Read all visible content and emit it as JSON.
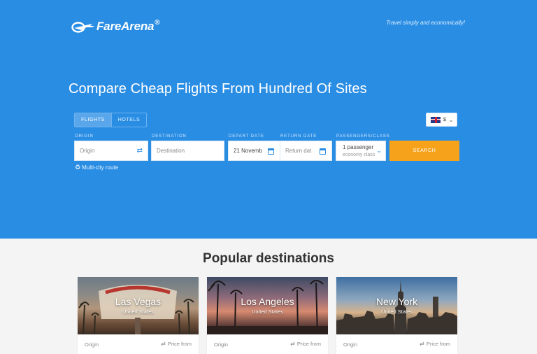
{
  "header": {
    "logo_text": "FareArena",
    "logo_reg": "®",
    "tagline": "Travel simply and economically!"
  },
  "hero": {
    "headline": "Compare Cheap Flights From Hundred Of Sites"
  },
  "tabs": [
    {
      "label": "FLIGHTS",
      "active": true
    },
    {
      "label": "HOTELS",
      "active": false
    }
  ],
  "currency": {
    "symbol": "$"
  },
  "search": {
    "origin_label": "ORIGIN",
    "origin_placeholder": "Origin",
    "destination_label": "DESTINATION",
    "destination_placeholder": "Destination",
    "depart_label": "DEPART DATE",
    "depart_value": "21 Novemb",
    "return_label": "RETURN DATE",
    "return_placeholder": "Return dat",
    "passengers_label": "PASSENGERS/CLASS",
    "passengers_value": "1 passenger",
    "class_value": "economy class",
    "search_button": "SEARCH",
    "multi_city": "Multi-city route"
  },
  "popular": {
    "title": "Popular destinations",
    "cards": [
      {
        "city": "Las Vegas",
        "country": "United States",
        "origin": "Origin",
        "price": "Price from"
      },
      {
        "city": "Los Angeles",
        "country": "United States",
        "origin": "Origin",
        "price": "Price from"
      },
      {
        "city": "New York",
        "country": "United States",
        "origin": "Origin",
        "price": "Price from"
      }
    ]
  },
  "colors": {
    "hero_bg": "#2a8de4",
    "search_button": "#f7a21b"
  }
}
